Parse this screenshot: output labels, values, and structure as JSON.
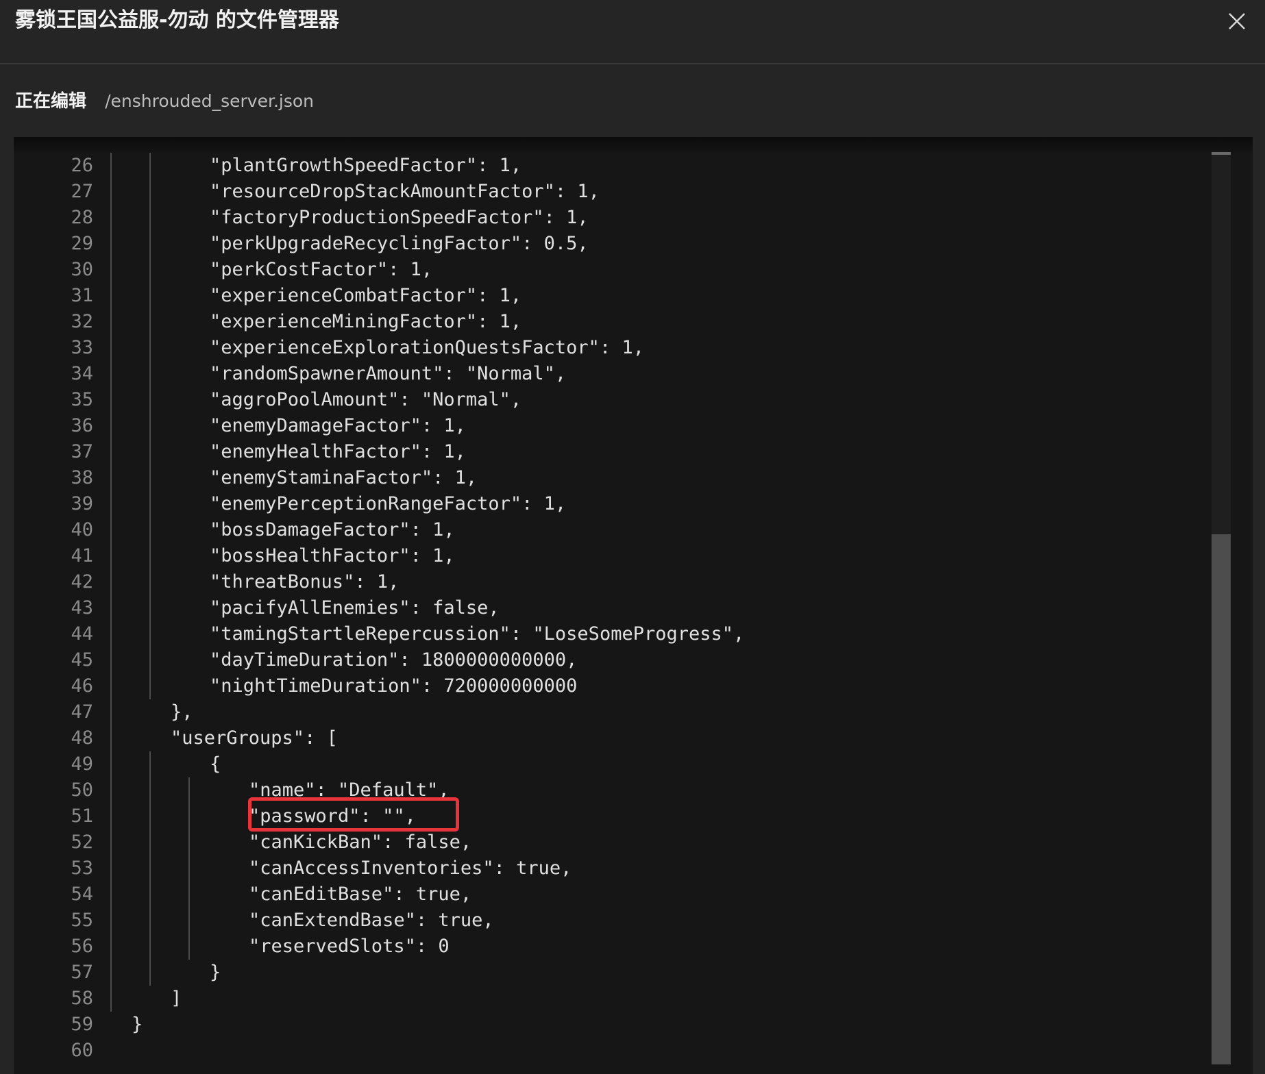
{
  "header": {
    "title": "雾锁王国公益服-勿动 的文件管理器",
    "close_icon": "close-icon"
  },
  "subbar": {
    "label": "正在编辑",
    "path": "/enshrouded_server.json"
  },
  "editor": {
    "language": "json",
    "highlighted_line": 51,
    "lines": [
      {
        "n": "26",
        "indent": 2,
        "text": "\"plantGrowthSpeedFactor\": 1,"
      },
      {
        "n": "27",
        "indent": 2,
        "text": "\"resourceDropStackAmountFactor\": 1,"
      },
      {
        "n": "28",
        "indent": 2,
        "text": "\"factoryProductionSpeedFactor\": 1,"
      },
      {
        "n": "29",
        "indent": 2,
        "text": "\"perkUpgradeRecyclingFactor\": 0.5,"
      },
      {
        "n": "30",
        "indent": 2,
        "text": "\"perkCostFactor\": 1,"
      },
      {
        "n": "31",
        "indent": 2,
        "text": "\"experienceCombatFactor\": 1,"
      },
      {
        "n": "32",
        "indent": 2,
        "text": "\"experienceMiningFactor\": 1,"
      },
      {
        "n": "33",
        "indent": 2,
        "text": "\"experienceExplorationQuestsFactor\": 1,"
      },
      {
        "n": "34",
        "indent": 2,
        "text": "\"randomSpawnerAmount\": \"Normal\","
      },
      {
        "n": "35",
        "indent": 2,
        "text": "\"aggroPoolAmount\": \"Normal\","
      },
      {
        "n": "36",
        "indent": 2,
        "text": "\"enemyDamageFactor\": 1,"
      },
      {
        "n": "37",
        "indent": 2,
        "text": "\"enemyHealthFactor\": 1,"
      },
      {
        "n": "38",
        "indent": 2,
        "text": "\"enemyStaminaFactor\": 1,"
      },
      {
        "n": "39",
        "indent": 2,
        "text": "\"enemyPerceptionRangeFactor\": 1,"
      },
      {
        "n": "40",
        "indent": 2,
        "text": "\"bossDamageFactor\": 1,"
      },
      {
        "n": "41",
        "indent": 2,
        "text": "\"bossHealthFactor\": 1,"
      },
      {
        "n": "42",
        "indent": 2,
        "text": "\"threatBonus\": 1,"
      },
      {
        "n": "43",
        "indent": 2,
        "text": "\"pacifyAllEnemies\": false,"
      },
      {
        "n": "44",
        "indent": 2,
        "text": "\"tamingStartleRepercussion\": \"LoseSomeProgress\","
      },
      {
        "n": "45",
        "indent": 2,
        "text": "\"dayTimeDuration\": 1800000000000,"
      },
      {
        "n": "46",
        "indent": 2,
        "text": "\"nightTimeDuration\": 720000000000"
      },
      {
        "n": "47",
        "indent": 1,
        "text": "},"
      },
      {
        "n": "48",
        "indent": 1,
        "text": "\"userGroups\": ["
      },
      {
        "n": "49",
        "indent": 2,
        "text": "{"
      },
      {
        "n": "50",
        "indent": 3,
        "text": "\"name\": \"Default\","
      },
      {
        "n": "51",
        "indent": 3,
        "text": "\"password\": \"\","
      },
      {
        "n": "52",
        "indent": 3,
        "text": "\"canKickBan\": false,"
      },
      {
        "n": "53",
        "indent": 3,
        "text": "\"canAccessInventories\": true,"
      },
      {
        "n": "54",
        "indent": 3,
        "text": "\"canEditBase\": true,"
      },
      {
        "n": "55",
        "indent": 3,
        "text": "\"canExtendBase\": true,"
      },
      {
        "n": "56",
        "indent": 3,
        "text": "\"reservedSlots\": 0"
      },
      {
        "n": "57",
        "indent": 2,
        "text": "}"
      },
      {
        "n": "58",
        "indent": 1,
        "text": "]"
      },
      {
        "n": "59",
        "indent": 0,
        "text": "}"
      },
      {
        "n": "60",
        "indent": 0,
        "text": ""
      }
    ]
  }
}
